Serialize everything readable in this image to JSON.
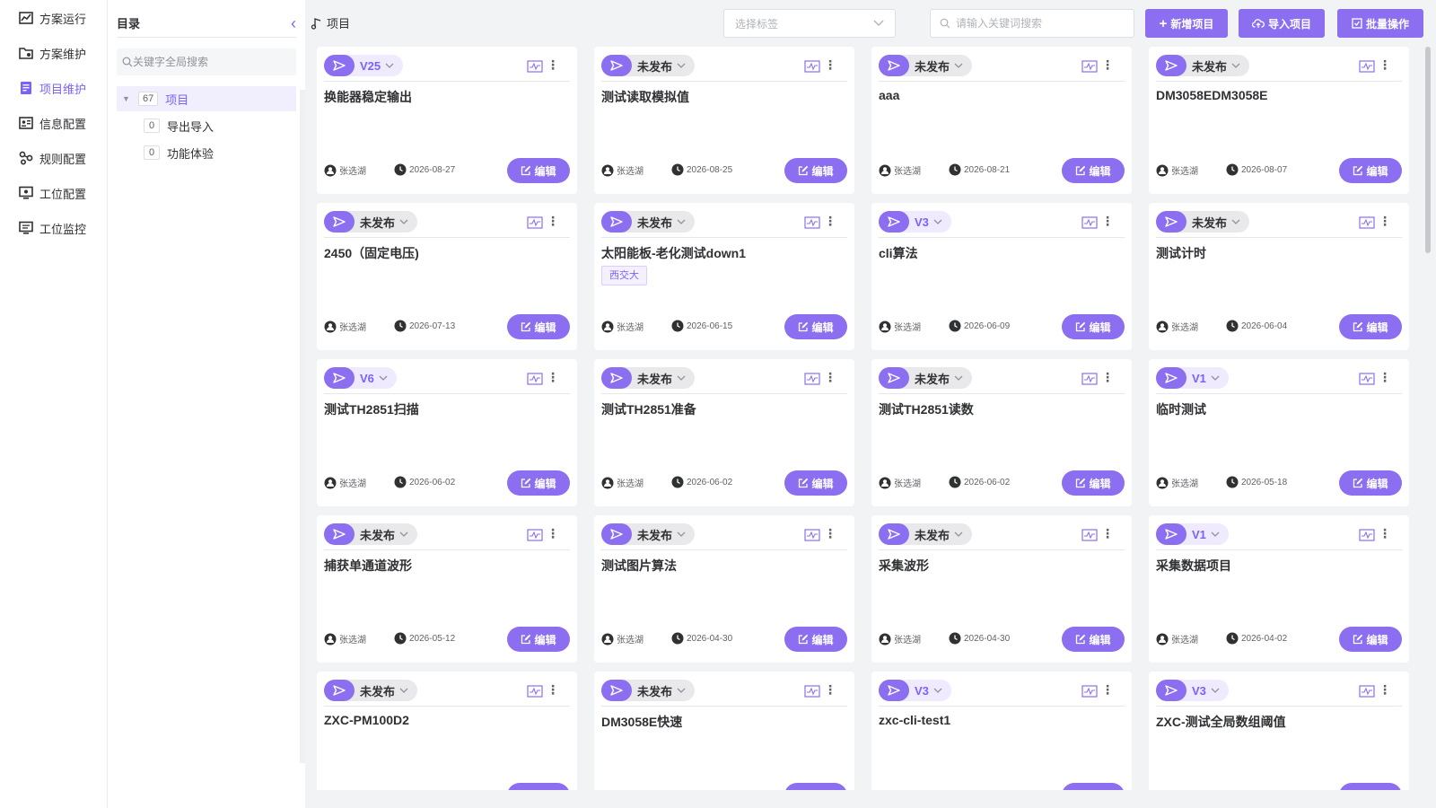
{
  "nav": {
    "items": [
      {
        "label": "方案运行",
        "icon": "chart-line-icon"
      },
      {
        "label": "方案维护",
        "icon": "folder-icon"
      },
      {
        "label": "项目维护",
        "icon": "document-icon"
      },
      {
        "label": "信息配置",
        "icon": "id-card-icon"
      },
      {
        "label": "规则配置",
        "icon": "nodes-icon"
      },
      {
        "label": "工位配置",
        "icon": "monitor-gear-icon"
      },
      {
        "label": "工位监控",
        "icon": "monitor-list-icon"
      }
    ],
    "active_index": 2
  },
  "tree": {
    "title": "目录",
    "search_placeholder": "关键字全局搜索",
    "root": {
      "count": "67",
      "label": "项目"
    },
    "children": [
      {
        "count": "0",
        "label": "导出导入"
      },
      {
        "count": "0",
        "label": "功能体验"
      }
    ]
  },
  "topbar": {
    "breadcrumb": "项目",
    "select_placeholder": "选择标签",
    "search_placeholder": "请输入关键词搜索",
    "buttons": {
      "add": "新增项目",
      "import": "导入项目",
      "batch": "批量操作"
    }
  },
  "edit_label": "编辑",
  "colors": {
    "accent": "#8b6ff0",
    "accent_text": "#7b61ff"
  },
  "cards": [
    {
      "status": "V25",
      "type": "version",
      "name": "换能器稳定输出",
      "tag": "",
      "user": "张选湖",
      "date": "2026-08-27"
    },
    {
      "status": "未发布",
      "type": "unpublished",
      "name": "测试读取模拟值",
      "tag": "",
      "user": "张选湖",
      "date": "2026-08-25"
    },
    {
      "status": "未发布",
      "type": "unpublished",
      "name": "aaa",
      "tag": "",
      "user": "张选湖",
      "date": "2026-08-21"
    },
    {
      "status": "未发布",
      "type": "unpublished",
      "name": "DM3058EDM3058E",
      "tag": "",
      "user": "张选湖",
      "date": "2026-08-07"
    },
    {
      "status": "未发布",
      "type": "unpublished",
      "name": "2450（固定电压)",
      "tag": "",
      "user": "张选湖",
      "date": "2026-07-13"
    },
    {
      "status": "未发布",
      "type": "unpublished",
      "name": "太阳能板-老化测试down1",
      "tag": "西交大",
      "user": "张选湖",
      "date": "2026-06-15"
    },
    {
      "status": "V3",
      "type": "version",
      "name": "cli算法",
      "tag": "",
      "user": "张选湖",
      "date": "2026-06-09"
    },
    {
      "status": "未发布",
      "type": "unpublished",
      "name": "测试计时",
      "tag": "",
      "user": "张选湖",
      "date": "2026-06-04"
    },
    {
      "status": "V6",
      "type": "version",
      "name": "测试TH2851扫描",
      "tag": "",
      "user": "张选湖",
      "date": "2026-06-02"
    },
    {
      "status": "未发布",
      "type": "unpublished",
      "name": "测试TH2851准备",
      "tag": "",
      "user": "张选湖",
      "date": "2026-06-02"
    },
    {
      "status": "未发布",
      "type": "unpublished",
      "name": "测试TH2851读数",
      "tag": "",
      "user": "张选湖",
      "date": "2026-06-02"
    },
    {
      "status": "V1",
      "type": "version",
      "name": "临时测试",
      "tag": "",
      "user": "张选湖",
      "date": "2026-05-18"
    },
    {
      "status": "未发布",
      "type": "unpublished",
      "name": "捕获单通道波形",
      "tag": "",
      "user": "张选湖",
      "date": "2026-05-12"
    },
    {
      "status": "未发布",
      "type": "unpublished",
      "name": "测试图片算法",
      "tag": "",
      "user": "张选湖",
      "date": "2026-04-30"
    },
    {
      "status": "未发布",
      "type": "unpublished",
      "name": "采集波形",
      "tag": "",
      "user": "张选湖",
      "date": "2026-04-30"
    },
    {
      "status": "V1",
      "type": "version",
      "name": "采集数据项目",
      "tag": "",
      "user": "张选湖",
      "date": "2026-04-02"
    },
    {
      "status": "未发布",
      "type": "unpublished",
      "name": "ZXC-PM100D2",
      "tag": "",
      "user": "",
      "date": ""
    },
    {
      "status": "未发布",
      "type": "unpublished",
      "name": "DM3058E快速",
      "tag": "",
      "user": "",
      "date": ""
    },
    {
      "status": "V3",
      "type": "version",
      "name": "zxc-cli-test1",
      "tag": "",
      "user": "",
      "date": ""
    },
    {
      "status": "V3",
      "type": "version",
      "name": "ZXC-测试全局数组阈值",
      "tag": "",
      "user": "",
      "date": ""
    }
  ]
}
